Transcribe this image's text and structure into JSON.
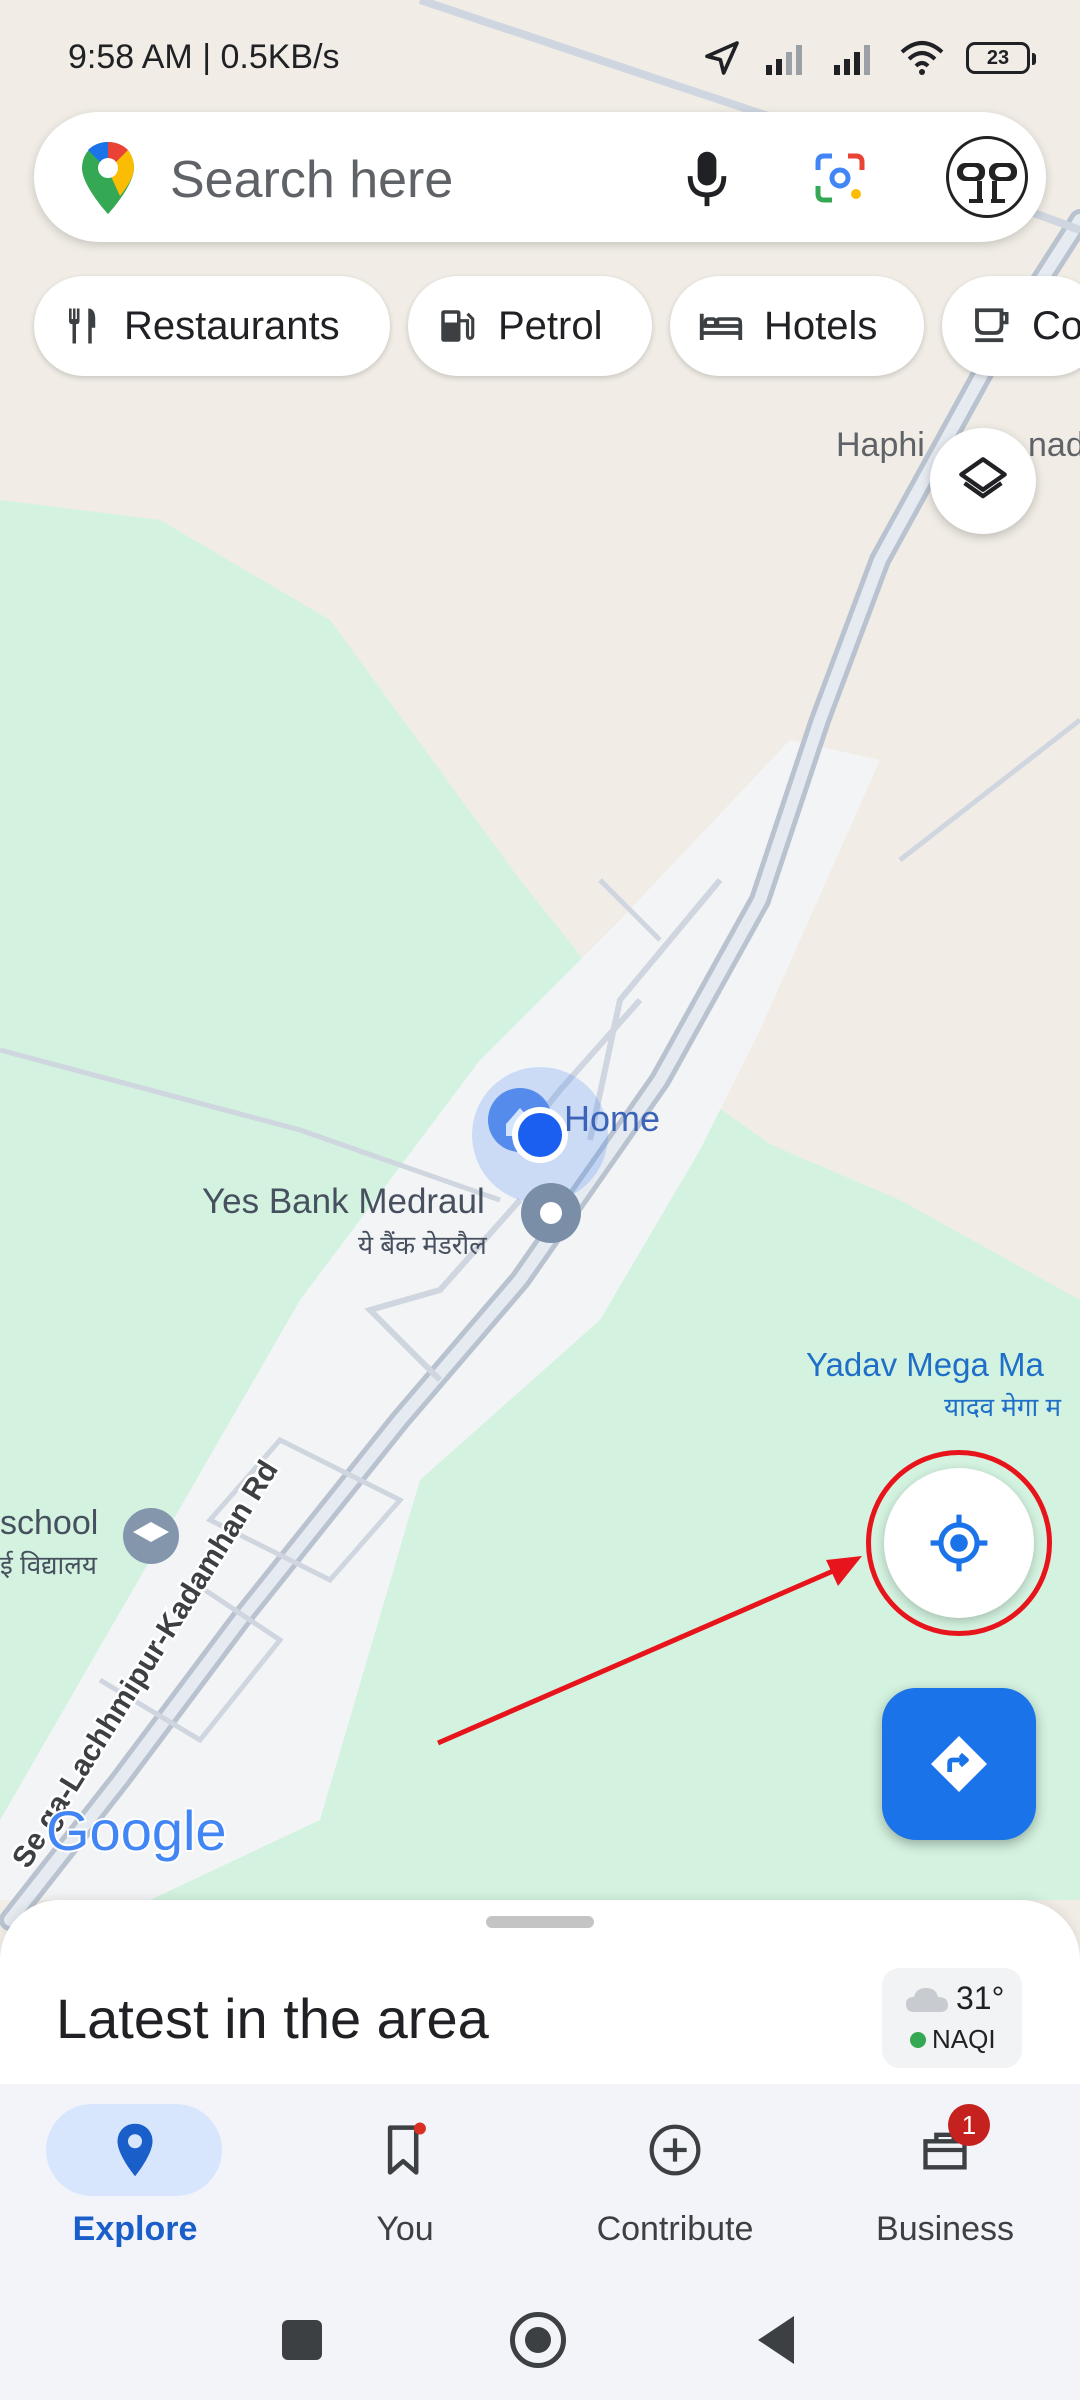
{
  "status_bar": {
    "time": "9:58 AM | 0.5KB/s",
    "battery": "23"
  },
  "search": {
    "placeholder": "Search here"
  },
  "chips": [
    {
      "label": "Restaurants",
      "icon": "fork-knife-icon"
    },
    {
      "label": "Petrol",
      "icon": "gas-station-icon"
    },
    {
      "label": "Hotels",
      "icon": "bed-icon"
    },
    {
      "label": "Co",
      "icon": "coffee-cup-icon"
    }
  ],
  "map": {
    "labels": {
      "haphi": "Haphi",
      "haphi_tail": "nad",
      "home": "Home",
      "bank_en": "Yes Bank Medraul",
      "bank_hi": "ये बैंक मेडरौल",
      "yadav_en": "Yadav Mega Ma",
      "yadav_hi": "यादव मेगा म",
      "school_en": "school",
      "school_hi": "ई विद्यालय",
      "road": "Se ga-Lachhmipur-Kadamhan Rd"
    },
    "google_logo": "Google"
  },
  "sheet": {
    "title": "Latest in the area",
    "weather_temp": "31°",
    "weather_aqi": "NAQI"
  },
  "nav": {
    "items": [
      {
        "label": "Explore",
        "icon": "map-pin-icon"
      },
      {
        "label": "You",
        "icon": "bookmark-icon"
      },
      {
        "label": "Contribute",
        "icon": "add-circle-icon"
      },
      {
        "label": "Business",
        "icon": "storefront-icon",
        "badge": "1"
      }
    ]
  },
  "colors": {
    "accent": "#1a73e8",
    "annotation": "#e8141c",
    "park": "#d4f3e0",
    "land": "#f1ede6"
  }
}
